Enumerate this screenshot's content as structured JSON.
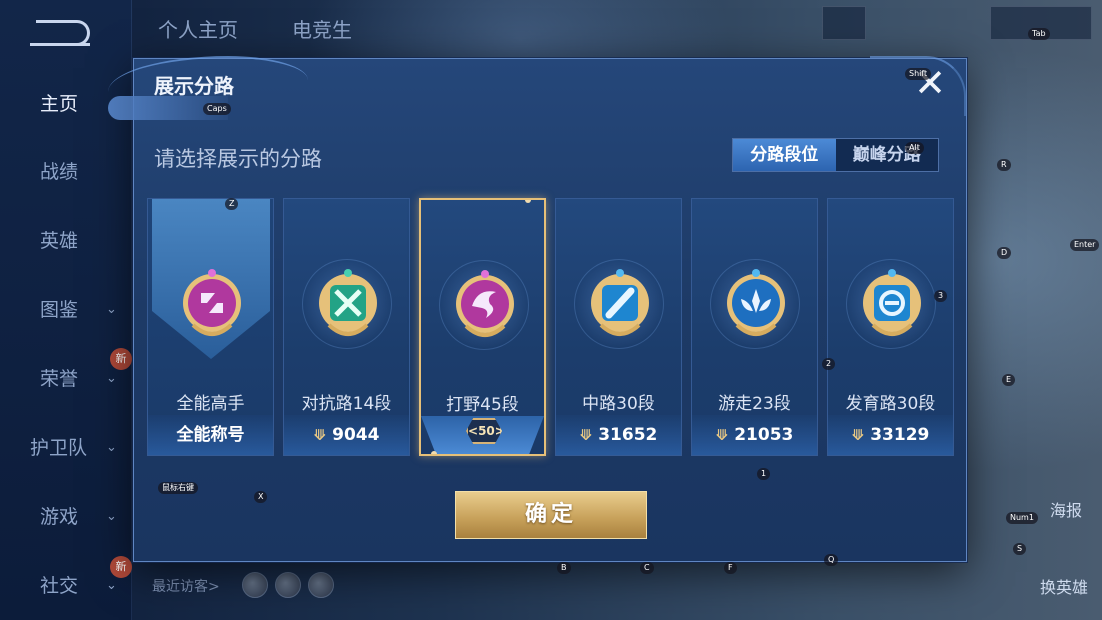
{
  "sidebar": {
    "items": [
      {
        "label": "主页"
      },
      {
        "label": "战绩"
      },
      {
        "label": "英雄"
      },
      {
        "label": "图鉴"
      },
      {
        "label": "荣誉"
      },
      {
        "label": "护卫队"
      },
      {
        "label": "游戏"
      },
      {
        "label": "社交"
      }
    ],
    "new_badge": "新"
  },
  "top_tabs": [
    {
      "label": "个人主页"
    },
    {
      "label": "电竞生"
    }
  ],
  "visitors_label": "最近访客>",
  "right_buttons": {
    "poster": "海报",
    "change_hero": "换英雄"
  },
  "modal": {
    "title": "展示分路",
    "subtitle": "请选择展示的分路",
    "segment": {
      "options": [
        {
          "label": "分路段位"
        },
        {
          "label": "巅峰分路"
        }
      ],
      "selected": "分路段位"
    },
    "cards": [
      {
        "name": "全能高手",
        "footer": "全能称号",
        "emblem_color": "#c04bc0"
      },
      {
        "name": "对抗路14段",
        "points": "9044",
        "emblem_color": "#2fb59a"
      },
      {
        "name": "打野45段",
        "badge": "50",
        "emblem_color": "#c04bc0",
        "selected": true
      },
      {
        "name": "中路30段",
        "points": "31652",
        "emblem_color": "#2a8fd8"
      },
      {
        "name": "游走23段",
        "points": "21053",
        "emblem_color": "#2a7ed0"
      },
      {
        "name": "发育路30段",
        "points": "33129",
        "emblem_color": "#2a8fd8"
      }
    ],
    "confirm_label": "确定"
  },
  "key_hints": [
    "Caps",
    "Z",
    "Shift",
    "Alt",
    "R",
    "D",
    "Enter",
    "3",
    "2",
    "E",
    "1",
    "X",
    "Num1",
    "S",
    "B",
    "C",
    "F",
    "Q",
    "Tab",
    "鼠标右键"
  ]
}
